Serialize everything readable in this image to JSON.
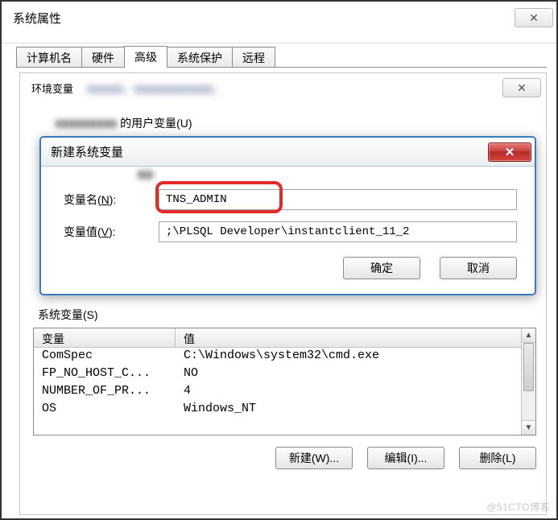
{
  "sysprops": {
    "title": "系统属性",
    "tabs": [
      "计算机名",
      "硬件",
      "高级",
      "系统保护",
      "远程"
    ],
    "active_tab_index": 2
  },
  "env": {
    "title": "环境变量",
    "user_group_label": "的用户变量(U)",
    "close_glyph": "✕"
  },
  "newvar": {
    "title": "新建系统变量",
    "close_glyph": "✕",
    "name_label_pre": "变量名(",
    "name_label_u": "N",
    "name_label_post": "):",
    "name_value": "TNS_ADMIN",
    "value_label_pre": "变量值(",
    "value_label_u": "V",
    "value_label_post": "):",
    "value_value": ";\\PLSQL Developer\\instantclient_11_2",
    "ok": "确定",
    "cancel": "取消"
  },
  "sysvars": {
    "label": "系统变量(S)",
    "header_var": "变量",
    "header_val": "值",
    "rows": [
      {
        "name": "ComSpec",
        "value": "C:\\Windows\\system32\\cmd.exe"
      },
      {
        "name": "FP_NO_HOST_C...",
        "value": "NO"
      },
      {
        "name": "NUMBER_OF_PR...",
        "value": "4"
      },
      {
        "name": "OS",
        "value": "Windows_NT"
      }
    ],
    "btn_new": "新建(W)...",
    "btn_edit": "编辑(I)...",
    "btn_del": "删除(L)"
  },
  "watermark": "@51CTO博客"
}
